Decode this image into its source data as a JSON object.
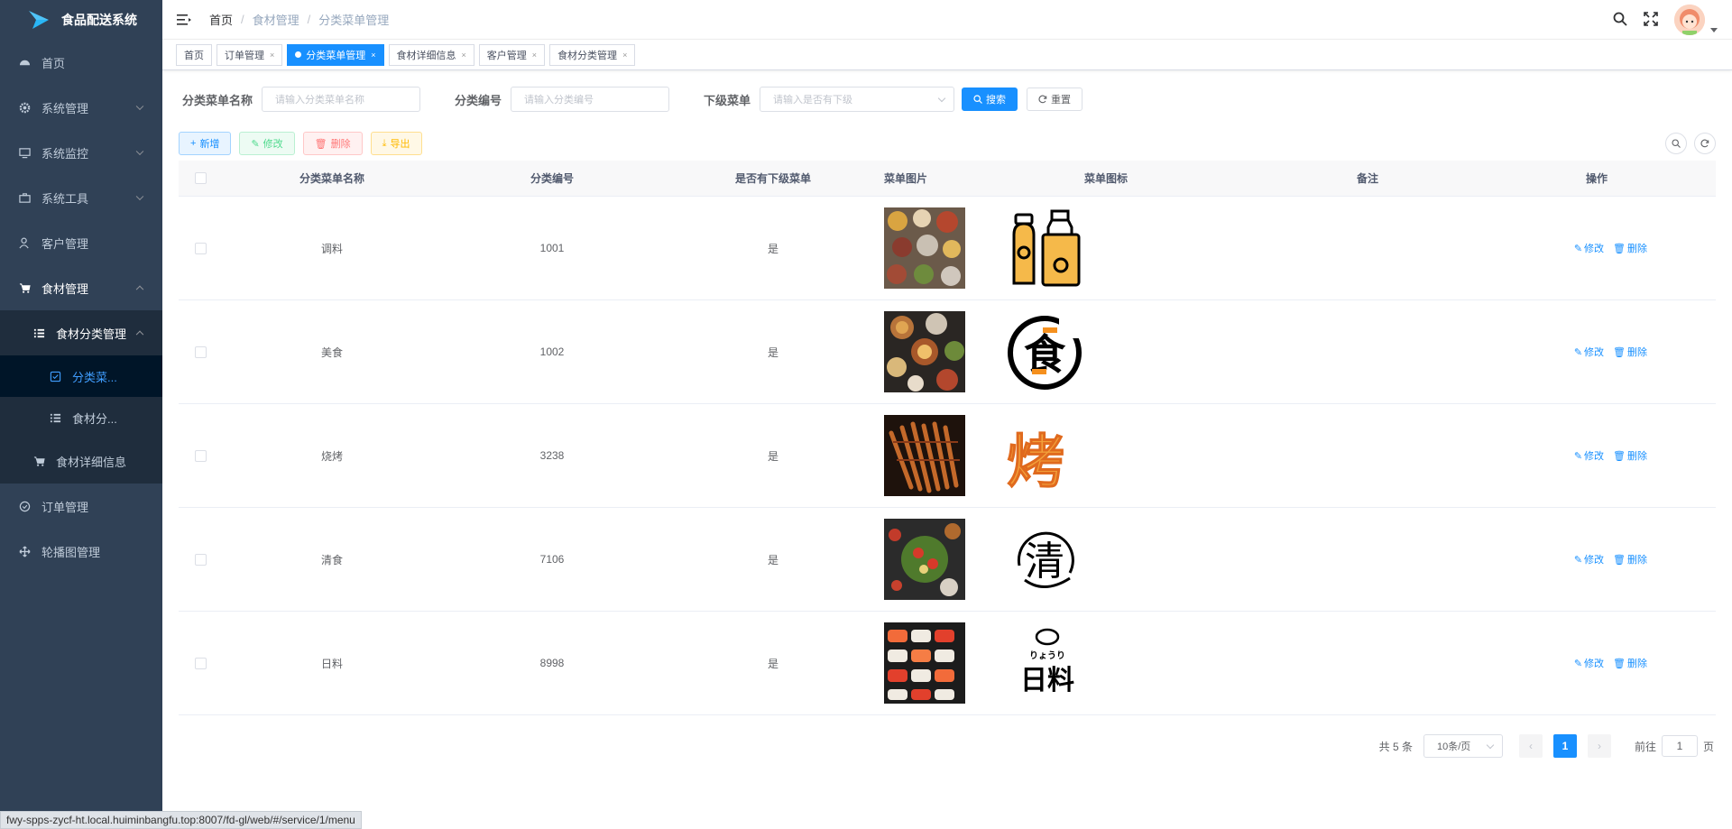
{
  "app": {
    "title": "食品配送系统"
  },
  "sidebar": {
    "items": [
      {
        "label": "首页",
        "icon": "dashboard-icon"
      },
      {
        "label": "系统管理",
        "icon": "gear-icon"
      },
      {
        "label": "系统监控",
        "icon": "monitor-icon"
      },
      {
        "label": "系统工具",
        "icon": "toolbox-icon"
      },
      {
        "label": "客户管理",
        "icon": "user-icon"
      },
      {
        "label": "食材管理",
        "icon": "cart-icon"
      },
      {
        "label": "食材分类管理",
        "icon": "list-icon"
      },
      {
        "label": "分类菜...",
        "icon": "checkbox-icon"
      },
      {
        "label": "食材分...",
        "icon": "list-icon"
      },
      {
        "label": "食材详细信息",
        "icon": "cart-icon"
      },
      {
        "label": "订单管理",
        "icon": "circle-check-icon"
      },
      {
        "label": "轮播图管理",
        "icon": "move-icon"
      }
    ]
  },
  "breadcrumb": [
    "首页",
    "食材管理",
    "分类菜单管理"
  ],
  "tags": [
    "首页",
    "订单管理",
    "分类菜单管理",
    "食材详细信息",
    "客户管理",
    "食材分类管理"
  ],
  "search": {
    "name_label": "分类菜单名称",
    "name_placeholder": "请输入分类菜单名称",
    "code_label": "分类编号",
    "code_placeholder": "请输入分类编号",
    "sub_label": "下级菜单",
    "sub_placeholder": "请输入是否有下级",
    "search_btn": "搜索",
    "reset_btn": "重置"
  },
  "toolbar": {
    "add": "新增",
    "edit": "修改",
    "delete": "删除",
    "export": "导出"
  },
  "table": {
    "headers": [
      "分类菜单名称",
      "分类编号",
      "是否有下级菜单",
      "菜单图片",
      "菜单图标",
      "备注",
      "操作"
    ],
    "rows": [
      {
        "name": "调料",
        "code": "1001",
        "has_sub": "是",
        "remark": ""
      },
      {
        "name": "美食",
        "code": "1002",
        "has_sub": "是",
        "remark": ""
      },
      {
        "name": "烧烤",
        "code": "3238",
        "has_sub": "是",
        "remark": ""
      },
      {
        "name": "清食",
        "code": "7106",
        "has_sub": "是",
        "remark": ""
      },
      {
        "name": "日料",
        "code": "8998",
        "has_sub": "是",
        "remark": ""
      }
    ],
    "op_edit": "修改",
    "op_delete": "删除",
    "icon_texts": {
      "meishi": "食",
      "shaokao": "烤",
      "qingshi": "清",
      "riliao_top": "りょうり",
      "riliao_main": "日料"
    }
  },
  "pagination": {
    "total": "共 5 条",
    "page_size": "10条/页",
    "current": "1",
    "goto_label": "前往",
    "goto_value": "1",
    "page_suffix": "页"
  },
  "statusbar": {
    "url": "fwy-spps-zycf-ht.local.huiminbangfu.top:8007/fd-gl/web/#/service/1/menu"
  }
}
